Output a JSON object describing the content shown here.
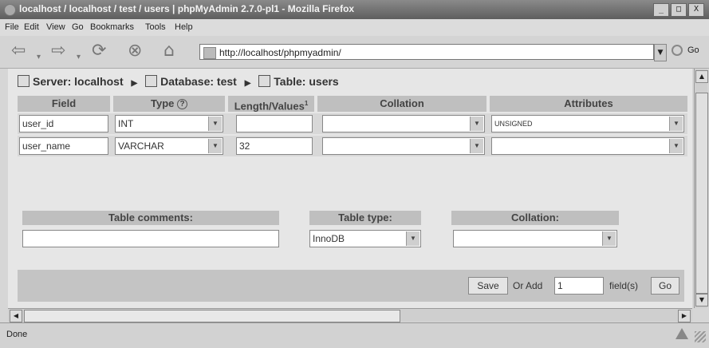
{
  "window": {
    "title": "localhost / localhost / test / users | phpMyAdmin 2.7.0-pl1 - Mozilla Firefox",
    "minimize": "_",
    "maximize": "□",
    "close": "X"
  },
  "menu": [
    "File",
    "Edit",
    "View",
    "Go",
    "Bookmarks",
    "Tools",
    "Help"
  ],
  "nav": {
    "url": "http://localhost/phpmyadmin/",
    "go_label": "Go"
  },
  "breadcrumb": {
    "server": "Server: localhost",
    "database": "Database: test",
    "table": "Table: users"
  },
  "table": {
    "headers": [
      "Field",
      "Type",
      "Length/Values",
      "Collation",
      "Attributes"
    ],
    "length_footnote": "1",
    "rows": [
      {
        "field": "user_id",
        "type": "INT",
        "length": "",
        "collation": "",
        "attributes": "UNSIGNED"
      },
      {
        "field": "user_name",
        "type": "VARCHAR",
        "length": "32",
        "collation": "",
        "attributes": ""
      }
    ]
  },
  "options": {
    "table_comments_label": "Table comments:",
    "table_comments_value": "",
    "table_type_label": "Table type:",
    "table_type_value": "InnoDB",
    "collation_label": "Collation:",
    "collation_value": ""
  },
  "footer": {
    "save_label": "Save",
    "or_add_label": "Or Add",
    "add_count": "1",
    "fields_label": "field(s)",
    "go_label": "Go"
  },
  "status": {
    "text": "Done"
  },
  "icons": {
    "back": "back-arrow-icon",
    "forward": "forward-arrow-icon",
    "reload": "reload-icon",
    "stop": "stop-icon",
    "home": "home-icon",
    "help": "help-icon"
  }
}
